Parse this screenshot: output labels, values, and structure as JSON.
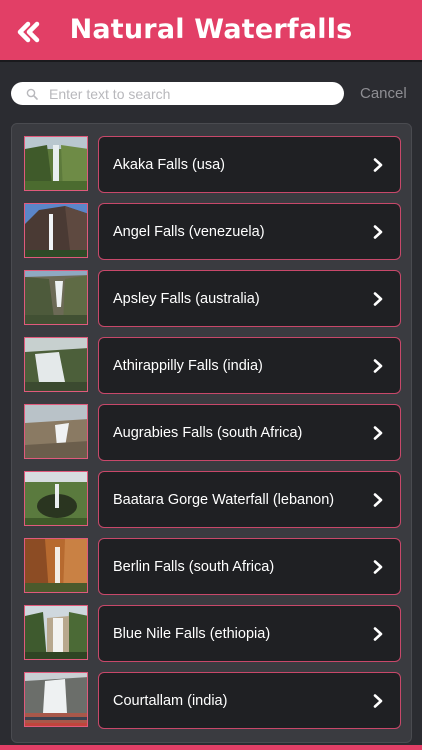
{
  "header": {
    "title": "Natural Waterfalls",
    "back_icon": "double-chevron-left-icon",
    "background": "#e23f66"
  },
  "search": {
    "placeholder": "Enter text to search",
    "value": "",
    "cancel_label": "Cancel"
  },
  "list": {
    "items": [
      {
        "label": "Akaka Falls (usa)",
        "thumb": "akaka"
      },
      {
        "label": "Angel Falls (venezuela)",
        "thumb": "angel"
      },
      {
        "label": "Apsley Falls (australia)",
        "thumb": "apsley"
      },
      {
        "label": "Athirappilly Falls (india)",
        "thumb": "athirappilly"
      },
      {
        "label": "Augrabies Falls (south Africa)",
        "thumb": "augrabies"
      },
      {
        "label": "Baatara Gorge Waterfall (lebanon)",
        "thumb": "baatara"
      },
      {
        "label": "Berlin Falls (south Africa)",
        "thumb": "berlin"
      },
      {
        "label": "Blue Nile Falls (ethiopia)",
        "thumb": "bluenile"
      },
      {
        "label": "Courtallam (india)",
        "thumb": "courtallam"
      }
    ],
    "chevron_icon": "chevron-right-icon"
  },
  "colors": {
    "accent": "#e23f66",
    "row_background": "#1f2023",
    "row_border": "#c8486a",
    "panel": "#3a3b40",
    "page": "#2b2c31"
  }
}
